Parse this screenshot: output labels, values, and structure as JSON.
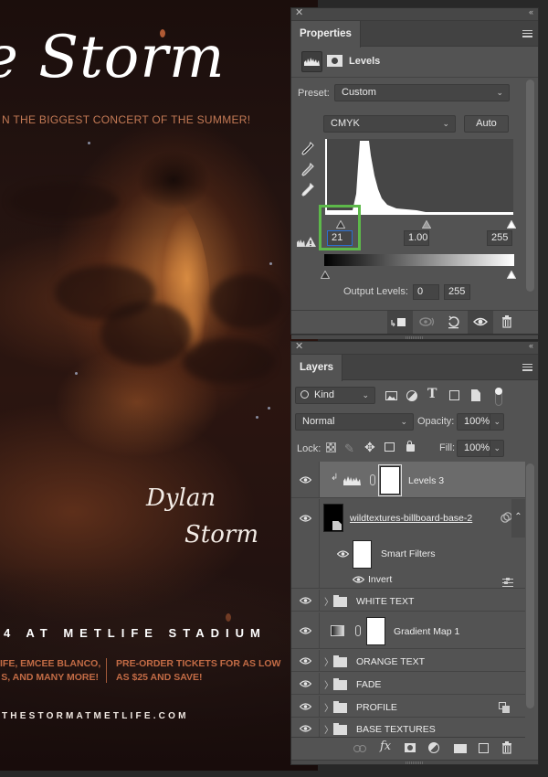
{
  "poster": {
    "title": "e Storm",
    "tagline": "N THE BIGGEST CONCERT OF THE SUMMER!",
    "artist_first": "Dylan",
    "artist_last": "Storm",
    "venue": "4 AT METLIFE STADIUM",
    "lineup_line1": "IFE, EMCEE BLANCO,",
    "lineup_line2": "S, AND MANY MORE!",
    "tickets_line1": "PRE-ORDER TICKETS FOR AS LOW",
    "tickets_line2": "AS $25 AND SAVE!",
    "url": "THESTORMATMETLIFE.COM",
    "colors": {
      "background": "#1a0d0b",
      "accent_orange": "#c26b45",
      "text_white": "#ffffff"
    }
  },
  "properties_panel": {
    "close_icon": "close-icon",
    "collapse_label": "‹‹",
    "tab_label": "Properties",
    "adjustment_title": "Levels",
    "preset_label": "Preset:",
    "preset_value": "Custom",
    "channel_value": "CMYK",
    "auto_button": "Auto",
    "input_black": "21",
    "input_gamma": "1.00",
    "input_white": "255",
    "output_levels_label": "Output Levels:",
    "output_black": "0",
    "output_white": "255",
    "highlight_color": "#5db94a",
    "footer_icons": [
      "clip-to-layer-icon",
      "view-previous-state-icon",
      "reset-icon",
      "toggle-visibility-icon",
      "delete-icon"
    ]
  },
  "layers_panel": {
    "close_icon": "close-icon",
    "collapse_label": "‹‹",
    "tab_label": "Layers",
    "filter_kind": "Kind",
    "blend_mode": "Normal",
    "opacity_label": "Opacity:",
    "opacity_value": "100%",
    "lock_label": "Lock:",
    "fill_label": "Fill:",
    "fill_value": "100%",
    "layers": [
      {
        "name": "Levels 3",
        "type": "adjustment",
        "visible": true,
        "selected": true
      },
      {
        "name": "wildtextures-billboard-base-2",
        "type": "smart-object",
        "visible": true
      },
      {
        "name": "Smart Filters",
        "type": "smart-filters",
        "visible": true
      },
      {
        "name": "Invert",
        "type": "filter",
        "visible": true
      },
      {
        "name": "WHITE TEXT",
        "type": "group",
        "visible": true
      },
      {
        "name": "Gradient Map 1",
        "type": "adjustment",
        "visible": true
      },
      {
        "name": "ORANGE TEXT",
        "type": "group",
        "visible": true
      },
      {
        "name": "FADE",
        "type": "group",
        "visible": true
      },
      {
        "name": "PROFILE",
        "type": "group",
        "visible": true
      },
      {
        "name": "BASE TEXTURES",
        "type": "group",
        "visible": true
      }
    ],
    "footer_icons": [
      "link-layers-icon",
      "fx-icon",
      "add-mask-icon",
      "new-adjustment-icon",
      "new-group-icon",
      "new-layer-icon",
      "delete-icon"
    ]
  }
}
